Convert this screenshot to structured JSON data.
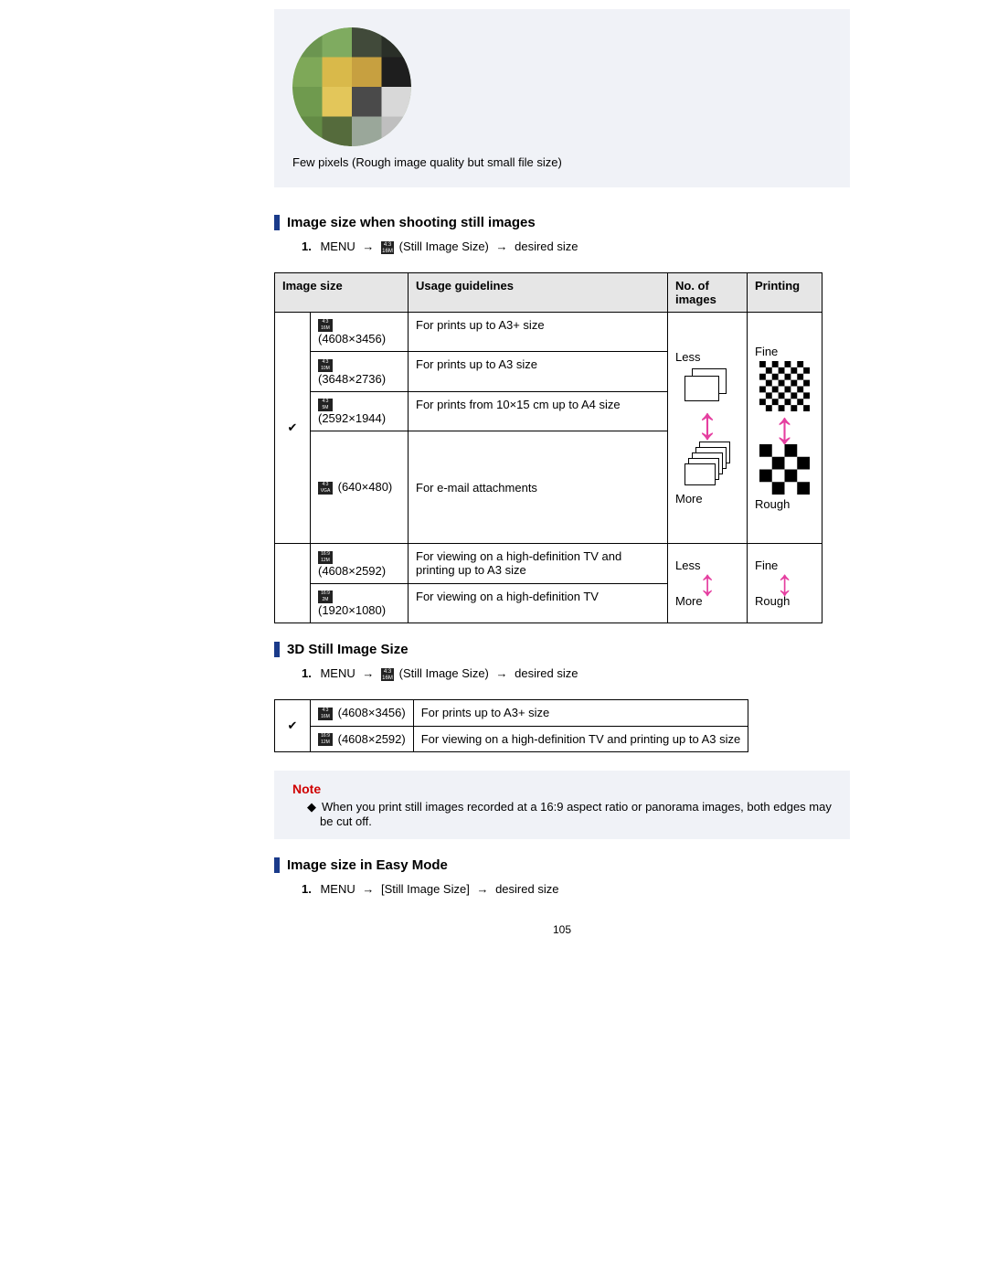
{
  "topbox": {
    "caption": "Few pixels (Rough image quality but small file size)"
  },
  "headings": {
    "h1": "Image size when shooting still images",
    "h2": "3D Still Image Size",
    "h3": "Image size in Easy Mode"
  },
  "instr1": {
    "num": "1.",
    "menu": "MENU",
    "still": "(Still Image Size)",
    "desired": "desired size"
  },
  "instr2": {
    "num": "1.",
    "menu": "MENU",
    "still": "(Still Image Size)",
    "desired": "desired size"
  },
  "instr3": {
    "num": "1.",
    "menu": "MENU",
    "still": "[Still Image Size]",
    "desired": "desired size"
  },
  "table_headers": {
    "c1": "Image size",
    "c2": "Usage guidelines",
    "c3": "No. of images",
    "c4": "Printing"
  },
  "table1": {
    "r1": {
      "res": "(4608×3456)",
      "use": "For prints up to A3+ size",
      "less": "Less",
      "fine": "Fine"
    },
    "r2": {
      "res": "(3648×2736)",
      "use": "For prints up to A3 size"
    },
    "r3": {
      "res": "(2592×1944)",
      "use": "For prints from 10×15 cm up to A4 size"
    },
    "r4": {
      "res": "(640×480)",
      "use": "For e-mail attachments",
      "more": "More",
      "rough": "Rough"
    },
    "r5": {
      "res": "(4608×2592)",
      "use": "For viewing on a high-definition TV and printing up to A3 size",
      "less": "Less",
      "fine": "Fine"
    },
    "r6": {
      "res": "(1920×1080)",
      "use": "For viewing on a high-definition TV",
      "more": "More",
      "rough": "Rough"
    }
  },
  "table2": {
    "r1": {
      "res": "(4608×3456)",
      "use": "For prints up to A3+ size"
    },
    "r2": {
      "res": "(4608×2592)",
      "use": "For viewing on a high-definition TV and printing up to A3 size"
    }
  },
  "note": {
    "title": "Note",
    "item1": "When you print still images recorded at a 16:9 aspect ratio or panorama images, both edges may be cut off."
  },
  "page_num": "105"
}
